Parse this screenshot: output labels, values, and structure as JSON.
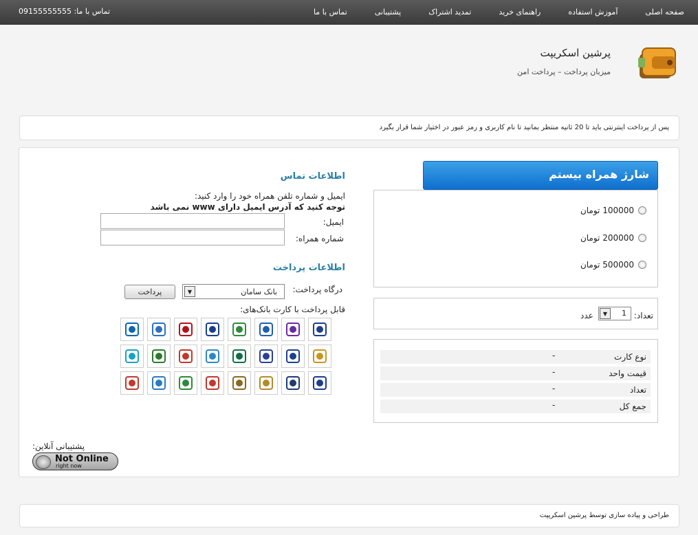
{
  "nav": {
    "items": [
      "صفحه اصلی",
      "آموزش استفاده",
      "راهنمای خرید",
      "تمدید اشتراک",
      "پشتیبانی",
      "تماس با ما"
    ],
    "contact": "تماس با ما: 09155555555"
  },
  "brand": {
    "title": "پرشین اسکریپت",
    "subtitle": "میزبان پرداخت – پرداخت امن",
    "logo_icon": "wallet-icon"
  },
  "notice": "پس از پرداخت اینترنتی باید تا 20 ثانیه منتظر بمانید تا نام کاربری و رمز عبور در اختیار شما قرار بگیرد",
  "product": {
    "title": "شارژ همراه بیستم",
    "amounts": [
      "100000 تومان",
      "200000 تومان",
      "500000 تومان"
    ],
    "quantity_label": "تعداد:",
    "quantity_value": "1",
    "quantity_unit": "عدد",
    "summary": [
      {
        "label": "نوع کارت",
        "value": "-"
      },
      {
        "label": "قیمت واحد",
        "value": "-"
      },
      {
        "label": "تعداد",
        "value": "-"
      },
      {
        "label": "جمع کل",
        "value": "-"
      }
    ],
    "header_color": "#1a7fd6"
  },
  "contact": {
    "title": "اطلاعات تماس",
    "instruction": "ایمیل و شماره تلفن همراه خود را وارد کنید:",
    "warning": "توجه کنید که آدرس ایمیل دارای www نمی باشد",
    "email_label": "ایمیل:",
    "email_value": "",
    "phone_label": "شماره همراه:",
    "phone_value": ""
  },
  "payment": {
    "title": "اطلاعات پرداخت",
    "gateway_label": "درگاه پرداخت:",
    "gateway_value": "بانک سامان",
    "pay_button": "پرداخت",
    "cards_label": "قابل پرداخت با کارت بانک‌های:",
    "banks": [
      "bank-mellat-icon",
      "bank-karafarin-icon",
      "bank-tejarat-icon",
      "bank-keshavarzi-icon",
      "bank-saderat-icon",
      "bank-mellat-red-icon",
      "bank-refah-icon",
      "bank-sepah-icon",
      "bank-pasargad-icon",
      "bank-sina-icon",
      "bank-ansar-icon",
      "bank-saman-icon",
      "bank-sarmayeh-icon",
      "bank-parsian-icon",
      "bank-eghtesad-icon",
      "bank-postbank-icon",
      "bank-melli-icon",
      "bank-eghtesad-novin-icon",
      "bank-tosee-icon",
      "bank-maskan-icon",
      "bank-hekmat-icon",
      "bank-ayandeh-icon",
      "bank-day-icon",
      "bank-ghavamin-icon"
    ],
    "accent_title_color": "#2a7fa6"
  },
  "support": {
    "label": "پشتیبانی آنلاین:",
    "status_big": "Not Online",
    "status_small": "right now"
  },
  "footer": "طراحی و پیاده سازی توسط پرشین اسکریپت"
}
